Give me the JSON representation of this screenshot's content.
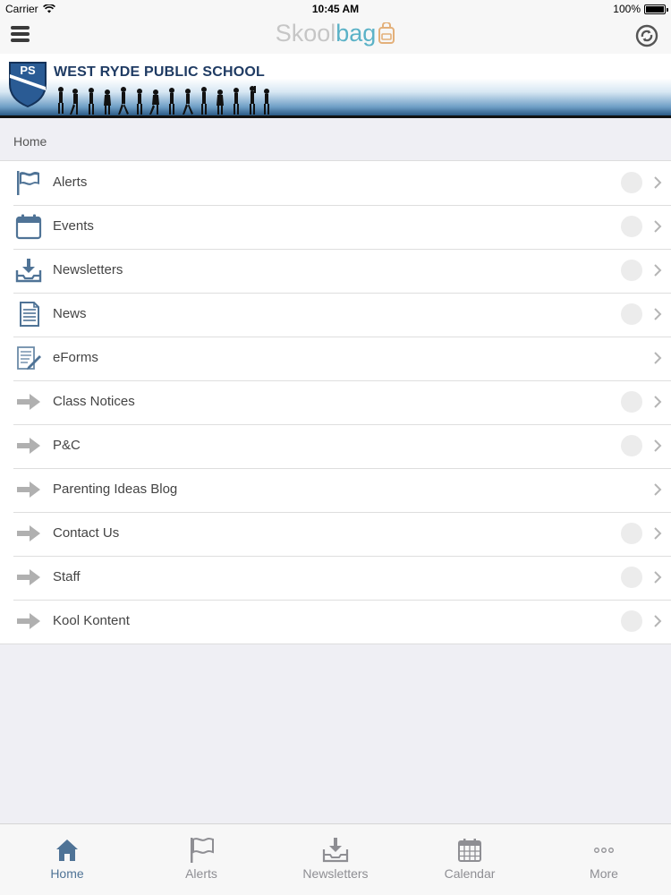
{
  "status_bar": {
    "carrier": "Carrier",
    "time": "10:45 AM",
    "battery": "100%"
  },
  "nav": {
    "brand_part1": "Skool",
    "brand_part2": "bag"
  },
  "banner": {
    "school_name": "WEST RYDE PUBLIC SCHOOL",
    "crest_letters": "PS"
  },
  "breadcrumb": "Home",
  "menu": [
    {
      "label": "Alerts",
      "icon": "flag-icon",
      "has_badge": true
    },
    {
      "label": "Events",
      "icon": "calendar-icon",
      "has_badge": true
    },
    {
      "label": "Newsletters",
      "icon": "download-tray-icon",
      "has_badge": true
    },
    {
      "label": "News",
      "icon": "document-icon",
      "has_badge": true
    },
    {
      "label": "eForms",
      "icon": "form-pen-icon",
      "has_badge": false
    },
    {
      "label": "Class Notices",
      "icon": "arrow-right-icon",
      "has_badge": true
    },
    {
      "label": "P&C",
      "icon": "arrow-right-icon",
      "has_badge": true
    },
    {
      "label": "Parenting Ideas Blog",
      "icon": "arrow-right-icon",
      "has_badge": false
    },
    {
      "label": "Contact Us",
      "icon": "arrow-right-icon",
      "has_badge": true
    },
    {
      "label": "Staff",
      "icon": "arrow-right-icon",
      "has_badge": true
    },
    {
      "label": "Kool Kontent",
      "icon": "arrow-right-icon",
      "has_badge": true
    }
  ],
  "tabs": [
    {
      "label": "Home",
      "icon": "home-icon",
      "active": true
    },
    {
      "label": "Alerts",
      "icon": "flag-icon",
      "active": false
    },
    {
      "label": "Newsletters",
      "icon": "download-tray-icon",
      "active": false
    },
    {
      "label": "Calendar",
      "icon": "calendar-grid-icon",
      "active": false
    },
    {
      "label": "More",
      "icon": "more-dots-icon",
      "active": false
    }
  ],
  "colors": {
    "accent": "#4f7396",
    "brand_blue": "#5bb2c7",
    "school_navy": "#1f3b63"
  }
}
